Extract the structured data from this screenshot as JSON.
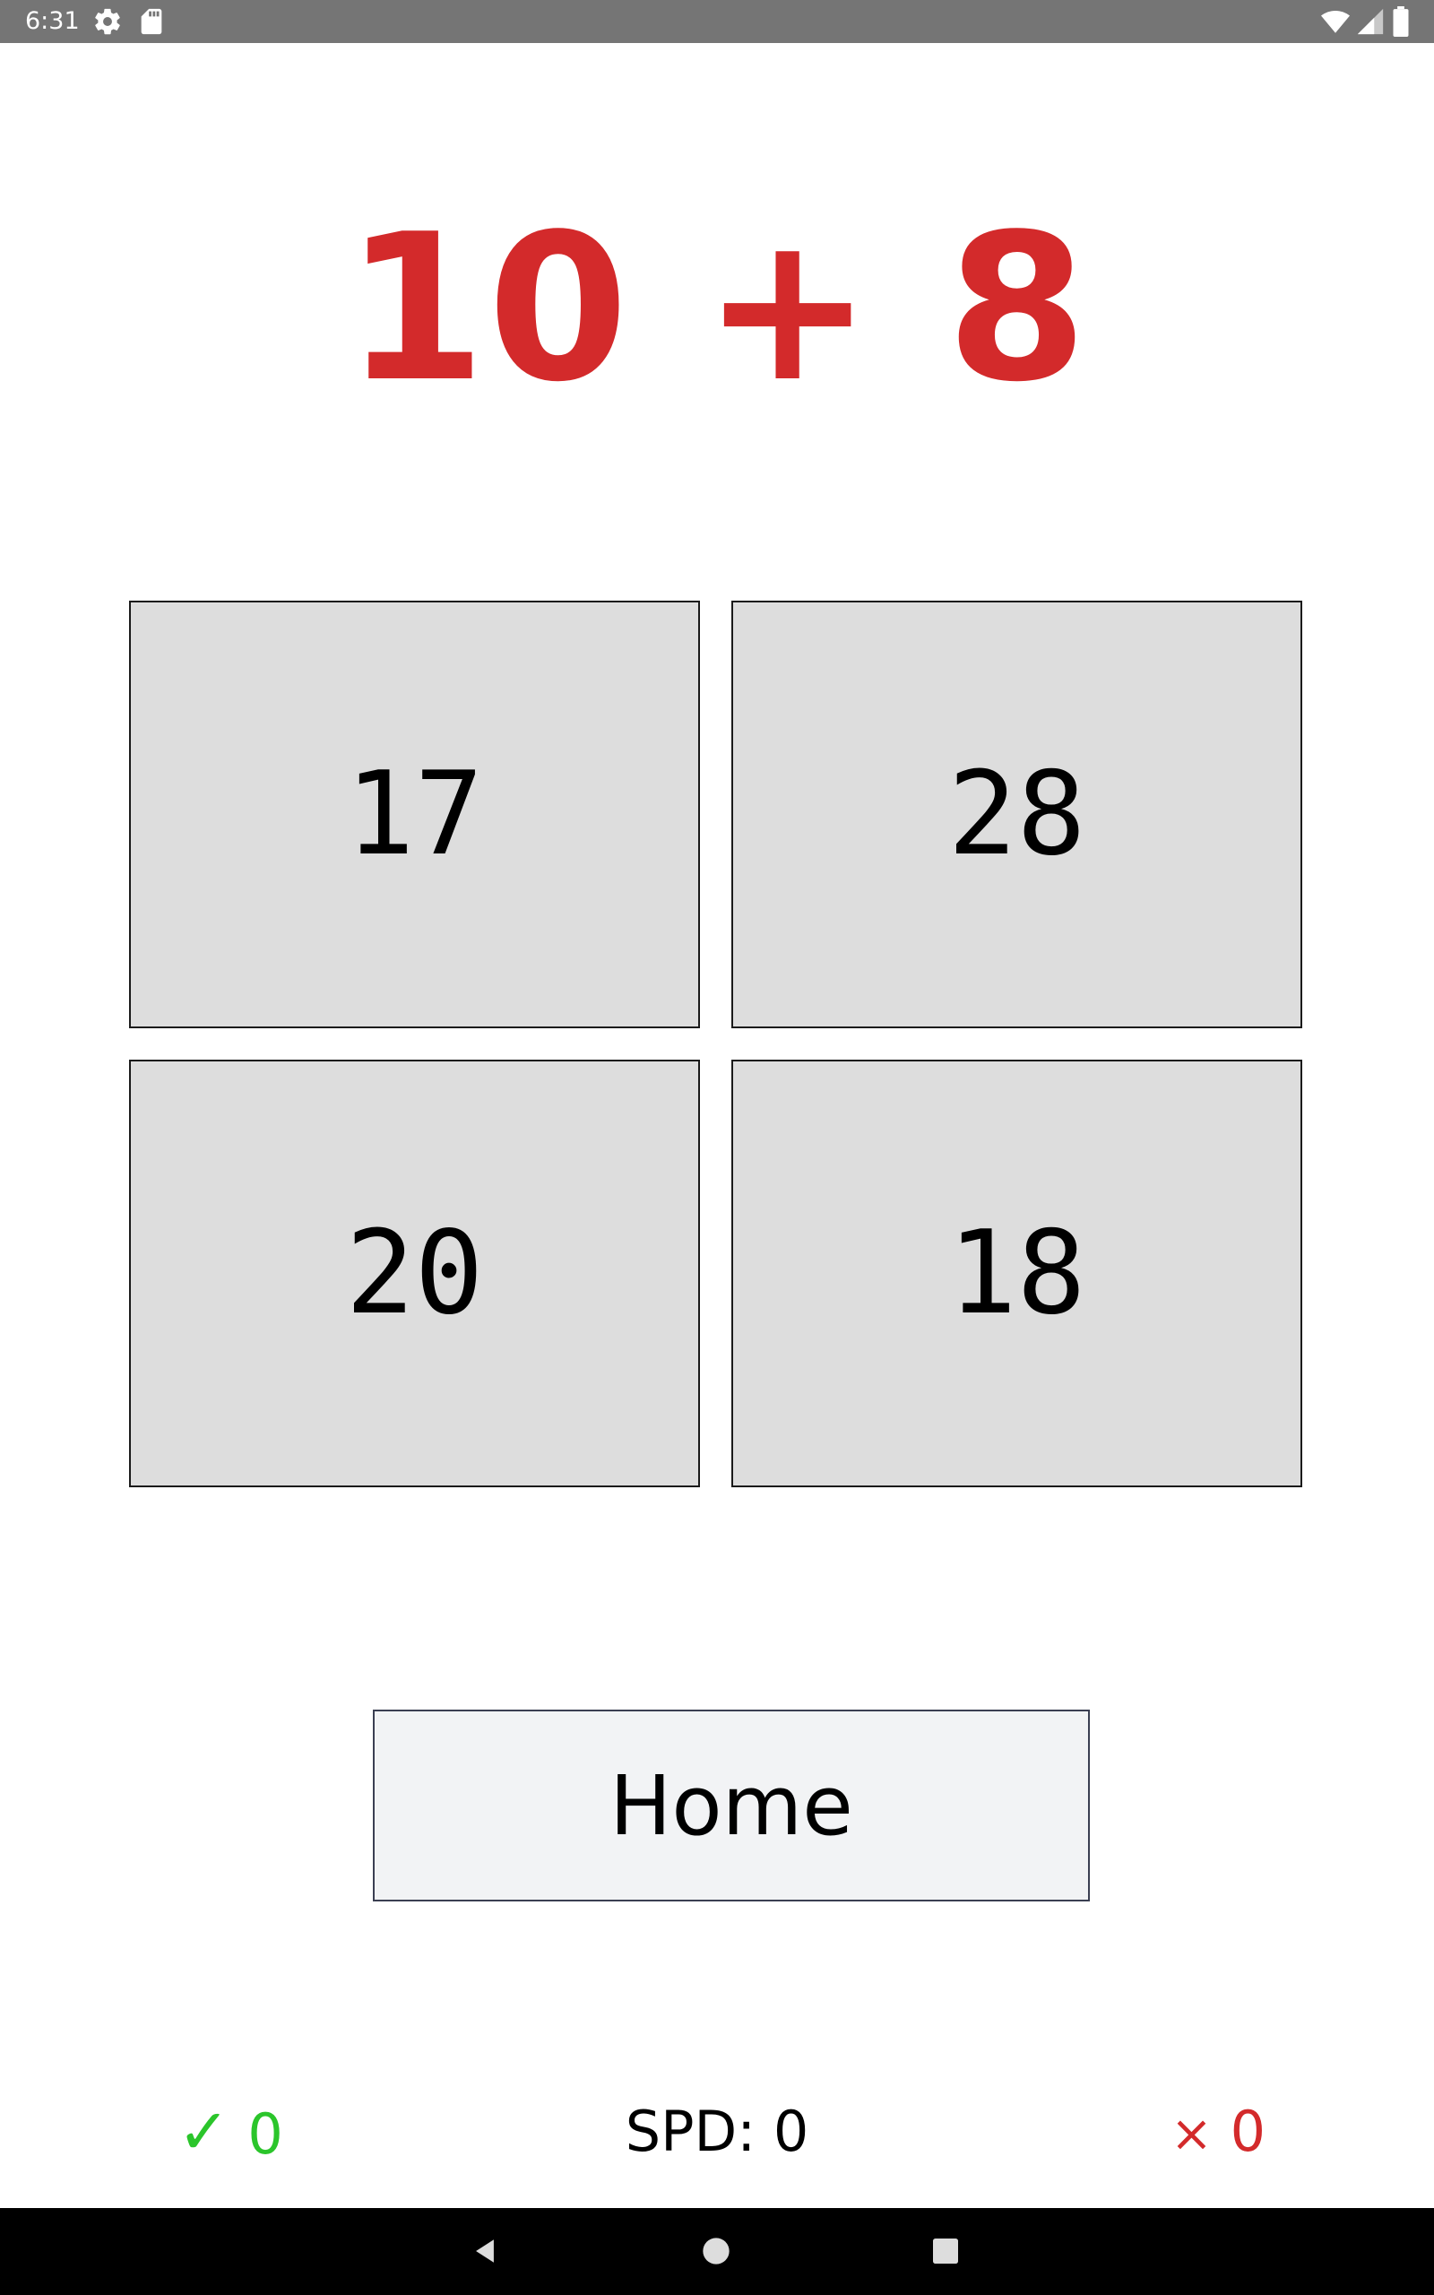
{
  "status_bar": {
    "time": "6:31",
    "icons": [
      "gear-icon",
      "sd-card-icon",
      "wifi-icon",
      "signal-icon",
      "battery-icon"
    ]
  },
  "problem": {
    "text": "10 + 8",
    "color": "#D32A2B"
  },
  "answers": [
    {
      "value": "17"
    },
    {
      "value": "28"
    },
    {
      "value": "20"
    },
    {
      "value": "18"
    }
  ],
  "home_button": {
    "label": "Home"
  },
  "score": {
    "correct_mark": "✓",
    "correct_count": "0",
    "speed_text": "SPD: 0",
    "wrong_mark": "×",
    "wrong_count": "0",
    "correct_color": "#2BC52B",
    "wrong_color": "#D32A2B"
  },
  "nav_bar": {
    "icons": [
      "back-icon",
      "home-icon",
      "recents-icon"
    ]
  }
}
